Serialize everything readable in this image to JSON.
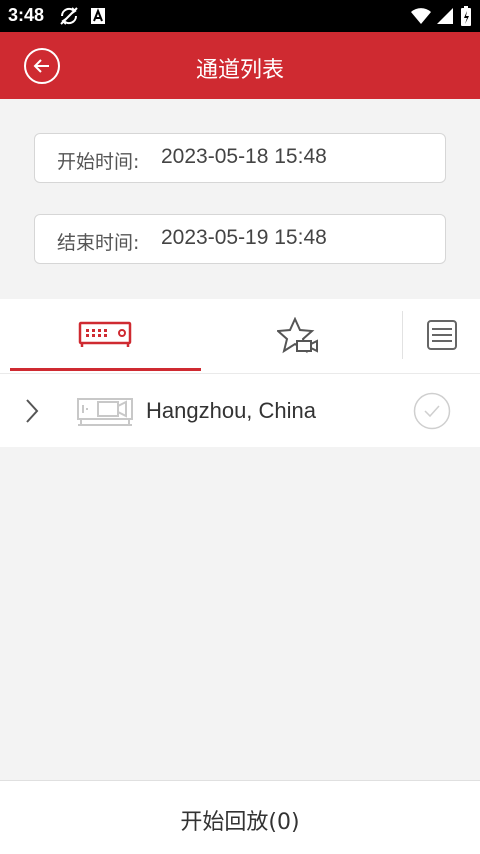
{
  "status_bar": {
    "time": "3:48"
  },
  "header": {
    "title": "通道列表"
  },
  "start_time": {
    "label": "开始时间:",
    "value": "2023-05-18 15:48"
  },
  "end_time": {
    "label": "结束时间:",
    "value": "2023-05-19 15:48"
  },
  "tabs": [
    {
      "icon": "dvr-device-icon",
      "active": true
    },
    {
      "icon": "favorite-camera-icon",
      "active": false
    },
    {
      "icon": "list-icon",
      "active": false
    }
  ],
  "devices": [
    {
      "name": "Hangzhou, China",
      "checked": false
    }
  ],
  "footer": {
    "playback_label": "开始回放(0)"
  },
  "colors": {
    "accent": "#cf2a31",
    "background": "#f3f3f3"
  }
}
